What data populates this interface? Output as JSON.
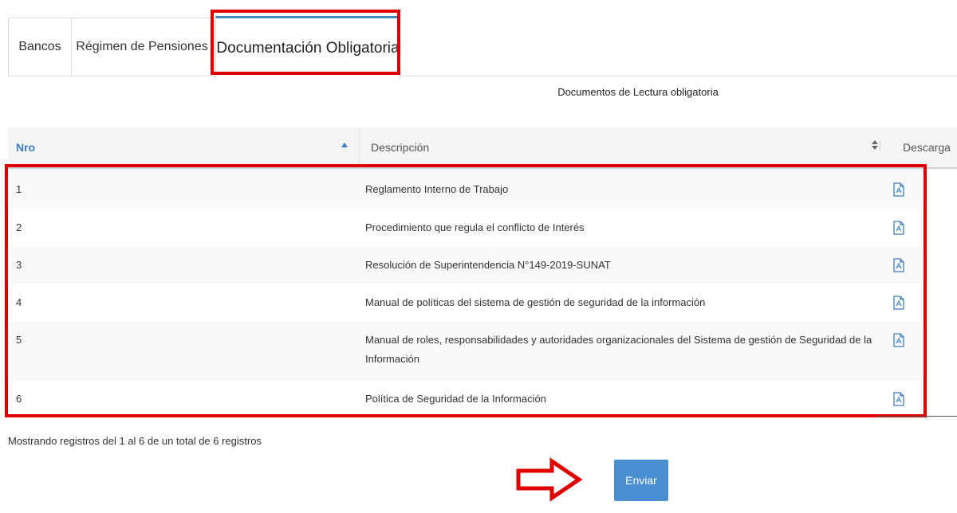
{
  "tabs": [
    {
      "label": "Bancos"
    },
    {
      "label": "Régimen de Pensiones"
    },
    {
      "label": "Documentación Obligatoria"
    }
  ],
  "section_title": "Documentos de Lectura obligatoria",
  "table": {
    "headers": {
      "nro": "Nro",
      "descripcion": "Descripción",
      "descarga": "Descarga"
    },
    "rows": [
      {
        "nro": "1",
        "descripcion": "Reglamento Interno de Trabajo",
        "download_icon": "pdf-file-icon"
      },
      {
        "nro": "2",
        "descripcion": "Procedimiento que regula el conflicto de Interés",
        "download_icon": "pdf-file-icon"
      },
      {
        "nro": "3",
        "descripcion": "Resolución de Superintendencia N°149-2019-SUNAT",
        "download_icon": "pdf-file-icon"
      },
      {
        "nro": "4",
        "descripcion": "Manual de políticas del sistema de gestión de seguridad de la información",
        "download_icon": "pdf-file-icon"
      },
      {
        "nro": "5",
        "descripcion": "Manual de roles, responsabilidades y autoridades organizacionales del Sistema de gestión de Seguridad de la Información",
        "download_icon": "pdf-file-icon"
      },
      {
        "nro": "6",
        "descripcion": "Política de Seguridad de la Información",
        "download_icon": "pdf-file-icon"
      }
    ]
  },
  "info": "Mostrando registros del 1 al 6 de un total de 6 registros",
  "submit_label": "Enviar",
  "colors": {
    "accent": "#3c7fc1",
    "button": "#4a8fd1",
    "highlight": "#e00000"
  }
}
